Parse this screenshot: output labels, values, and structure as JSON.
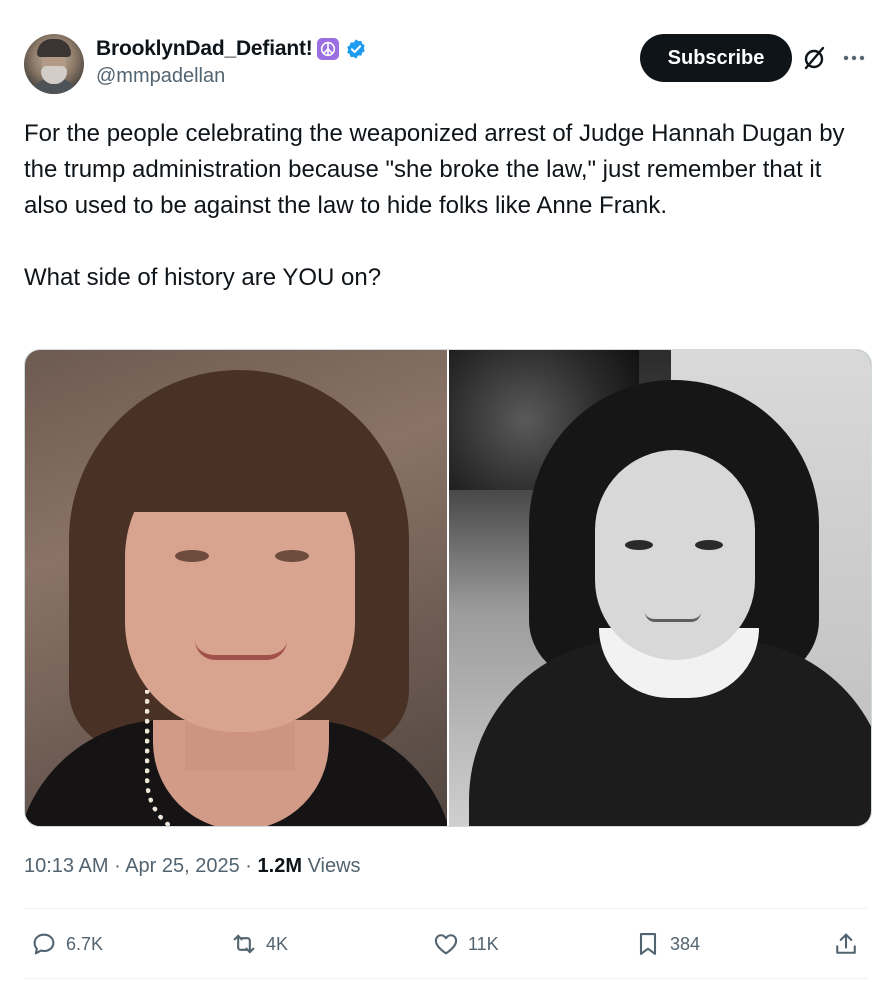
{
  "author": {
    "display_name": "BrooklynDad_Defiant!",
    "handle": "@mmpadellan",
    "badges": [
      "peace-sign-icon",
      "verified-badge-icon"
    ]
  },
  "header": {
    "subscribe_label": "Subscribe",
    "icons": [
      "grok-icon",
      "more-icon"
    ]
  },
  "tweet": {
    "text": "For the people celebrating the weaponized arrest of Judge Hannah Dugan by the trump administration because \"she broke the law,\" just remember that it also used to be against the law to hide folks like Anne Frank.\n\nWhat side of history are YOU on?"
  },
  "media": {
    "count": 2,
    "left_photo": "color portrait",
    "right_photo": "black and white portrait"
  },
  "meta": {
    "time": "10:13 AM",
    "separator": "·",
    "date": "Apr 25, 2025",
    "views_count": "1.2M",
    "views_label": "Views"
  },
  "actions": {
    "reply_count": "6.7K",
    "retweet_count": "4K",
    "like_count": "11K",
    "bookmark_count": "384"
  },
  "colors": {
    "text_primary": "#0f1419",
    "text_secondary": "#536471",
    "verified_blue": "#1d9bf0",
    "peace_purple": "#9b6fe0",
    "divider": "#eff3f4"
  }
}
